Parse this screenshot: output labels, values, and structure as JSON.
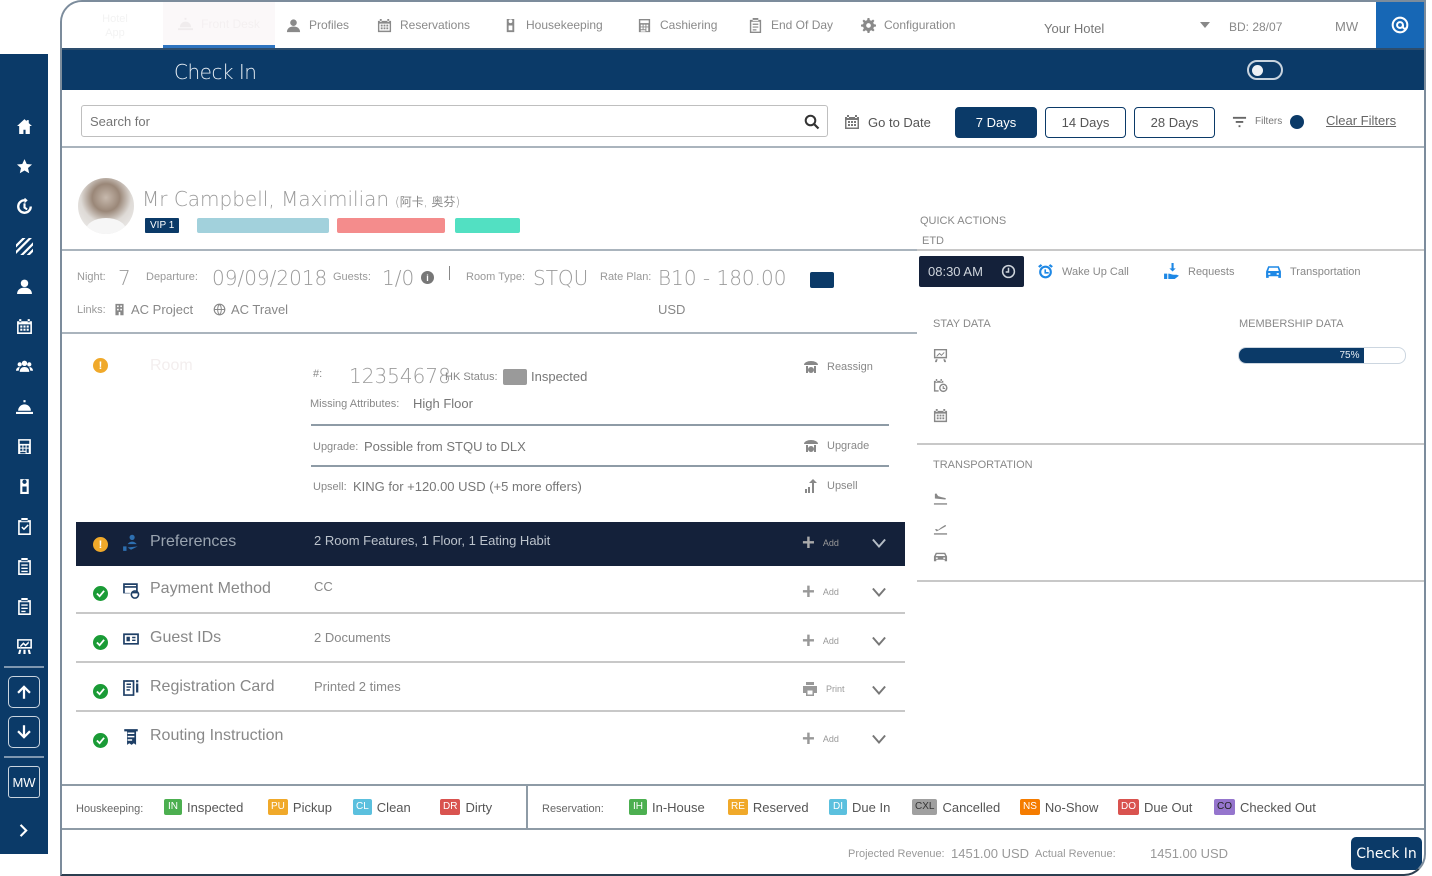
{
  "topnav": {
    "logo_text": "Hotel App",
    "items": [
      {
        "label": "Front Desk",
        "icon": "bell-icon",
        "active": true
      },
      {
        "label": "Profiles",
        "icon": "person-icon"
      },
      {
        "label": "Reservations",
        "icon": "calendar-icon"
      },
      {
        "label": "Housekeeping",
        "icon": "door-hanger-icon"
      },
      {
        "label": "Cashiering",
        "icon": "calculator-icon"
      },
      {
        "label": "End Of Day",
        "icon": "clipboard-icon"
      },
      {
        "label": "Configuration",
        "icon": "gear-icon"
      }
    ],
    "hotel": "Your Hotel",
    "business_date": "BD: 28/07",
    "user_initials": "MW"
  },
  "titlebar": {
    "title": "Check In"
  },
  "search": {
    "placeholder": "Search for",
    "go_to_date": "Go to Date",
    "day_buttons": [
      {
        "label": "7 Days",
        "active": true
      },
      {
        "label": "14 Days",
        "active": false
      },
      {
        "label": "28 Days",
        "active": false
      }
    ],
    "filters_label": "Filters",
    "clear_filters": "Clear Filters"
  },
  "guest": {
    "name": "Mr Campbell, Maximilian",
    "alt_name": "(阿卡, 奥芬)",
    "vip": "VIP 1",
    "tag_colors": [
      "#a2d1dc",
      "#f48c8c",
      "#52e0c2"
    ]
  },
  "stay": {
    "night_label": "Night:",
    "night_value": "7",
    "departure_label": "Departure:",
    "departure_value": "09/09/2018",
    "guests_label": "Guests:",
    "guests_value": "1/0",
    "room_type_label": "Room Type:",
    "room_type_value": "STQU",
    "rate_plan_label": "Rate Plan:",
    "rate_plan_value": "B10 - 180.00",
    "rate_currency": "USD",
    "links_label": "Links:",
    "links": [
      "AC Project",
      "AC Travel"
    ]
  },
  "room": {
    "title": "Room",
    "number_label": "#:",
    "number": "12354678",
    "hk_status_label": "HK Status:",
    "hk_status": "Inspected",
    "missing_label": "Missing Attributes:",
    "missing_value": "High Floor",
    "reassign": "Reassign",
    "upgrade_label": "Upgrade:",
    "upgrade_value": "Possible from STQU to DLX",
    "upgrade_action": "Upgrade",
    "upsell_label": "Upsell:",
    "upsell_value": "KING for +120.00 USD (+5 more offers)",
    "upsell_action": "Upsell"
  },
  "sections": [
    {
      "title": "Preferences",
      "summary": "2 Room Features, 1 Floor, 1 Eating Habit",
      "action": "Add",
      "status": "warning",
      "icon": "hand-person-icon"
    },
    {
      "title": "Payment Method",
      "summary": "CC",
      "action": "Add",
      "status": "ok",
      "icon": "payment-card-icon"
    },
    {
      "title": "Guest IDs",
      "summary": "2 Documents",
      "action": "Add",
      "status": "ok",
      "icon": "id-card-icon"
    },
    {
      "title": "Registration Card",
      "summary": "Printed 2 times",
      "action": "Print",
      "status": "ok",
      "icon": "document-icon"
    },
    {
      "title": "Routing Instruction",
      "summary": "",
      "action": "Add",
      "status": "ok",
      "icon": "receipt-icon"
    }
  ],
  "right_panel": {
    "quick_actions_label": "QUICK ACTIONS",
    "etd_label": "ETD",
    "etd_value": "08:30 AM",
    "actions": [
      "Wake Up Call",
      "Requests",
      "Transportation"
    ],
    "stay_data_label": "STAY DATA",
    "membership_label": "MEMBERSHIP DATA",
    "membership_progress": "75%",
    "membership_fraction": 0.75,
    "transportation_label": "TRANSPORTATION"
  },
  "legend": {
    "housekeeping_label": "Houskeeping:",
    "housekeeping": [
      {
        "code": "IN",
        "label": "Inspected",
        "color": "#4caf50"
      },
      {
        "code": "PU",
        "label": "Pickup",
        "color": "#f0a92a"
      },
      {
        "code": "CL",
        "label": "Clean",
        "color": "#5bc0de"
      },
      {
        "code": "DR",
        "label": "Dirty",
        "color": "#d9534f"
      }
    ],
    "reservation_label": "Reservation:",
    "reservation": [
      {
        "code": "IH",
        "label": "In-House",
        "color": "#4caf50"
      },
      {
        "code": "RE",
        "label": "Reserved",
        "color": "#f0a92a"
      },
      {
        "code": "DI",
        "label": "Due In",
        "color": "#5bc0de"
      },
      {
        "code": "CXL",
        "label": "Cancelled",
        "color": "#a0a0a0"
      },
      {
        "code": "NS",
        "label": "No-Show",
        "color": "#f57c00"
      },
      {
        "code": "DO",
        "label": "Due Out",
        "color": "#d9534f"
      },
      {
        "code": "CO",
        "label": "Checked Out",
        "color": "#9575cd"
      }
    ]
  },
  "footer": {
    "projected_label": "Projected Revenue:",
    "projected_value": "1451.00 USD",
    "actual_label": "Actual Revenue:",
    "actual_value": "1451.00 USD",
    "check_in_button": "Check In"
  },
  "sidebar": {
    "items": [
      "home-icon",
      "star-icon",
      "history-icon",
      "stripes-icon",
      "person-icon",
      "calendar-icon",
      "group-icon",
      "bell-icon",
      "calculator-icon",
      "door-hanger-icon",
      "clipboard-check-icon",
      "clipboard-list-icon",
      "clipboard-icon",
      "presentation-icon"
    ],
    "user_initials": "MW"
  },
  "colors": {
    "primary": "#0b3a68",
    "dark": "#14213a",
    "accent": "#1767b5",
    "warning": "#f0a92a",
    "success": "#1a9b36"
  }
}
